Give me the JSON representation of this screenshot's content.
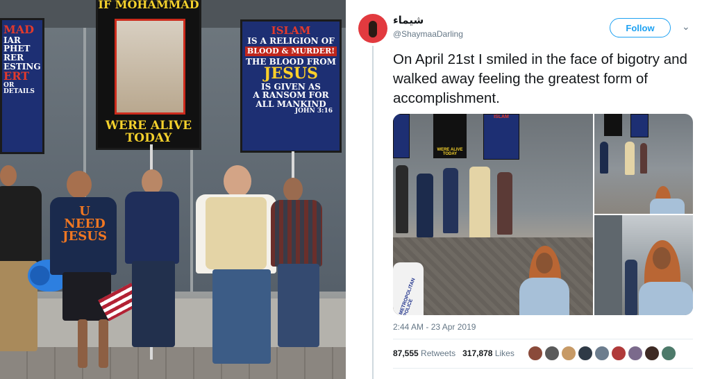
{
  "photo_left": {
    "sign_mohammad": {
      "top_text": "IF MOHAMMAD",
      "bottom_text": "WERE ALIVE TODAY"
    },
    "sign_islam": {
      "line1": "ISLAM",
      "line2": "IS A RELIGION OF",
      "line3": "BLOOD & MURDER!",
      "line4": "THE BLOOD FROM",
      "line5": "JESUS",
      "line6": "IS GIVEN AS",
      "line7": "A RANSOM FOR",
      "line8": "ALL MANKIND",
      "line9": "JOHN 3:16"
    },
    "sign_left": {
      "line1": "MAD",
      "line2": "IAR",
      "line3": "PHET",
      "line4": "RER",
      "line5": "ESTING",
      "line6": "ERT",
      "line7": "OR DETAILS"
    },
    "shirt_text": {
      "line1": "U",
      "line2": "NEED",
      "line3": "JESUS"
    }
  },
  "tweet": {
    "display_name": "شيماء",
    "handle": "@ShaymaaDarling",
    "follow_label": "Follow",
    "caret": "⌄",
    "text": "On April 21st I smiled in the face of bigotry and walked away feeling the greatest form of accomplishment.",
    "timestamp": "2:44 AM - 23 Apr 2019",
    "retweets_count": "87,555",
    "retweets_label": "Retweets",
    "likes_count": "317,878",
    "likes_label": "Likes",
    "media_sign_text": {
      "mini_islam": "ISLAM",
      "mini_wat": "WERE ALIVE TODAY",
      "police": "METROPOLITAN POLICE"
    }
  },
  "colors": {
    "twitter_blue": "#1da1f2",
    "text_primary": "#14171a",
    "text_secondary": "#657786",
    "sign_blue": "#1d2f73",
    "sign_red": "#c0261c",
    "sign_yellow": "#f4d12c",
    "hijab": "#b96634"
  },
  "icons": [
    "avatar-image",
    "chevron-down-icon",
    "liker-avatar"
  ]
}
